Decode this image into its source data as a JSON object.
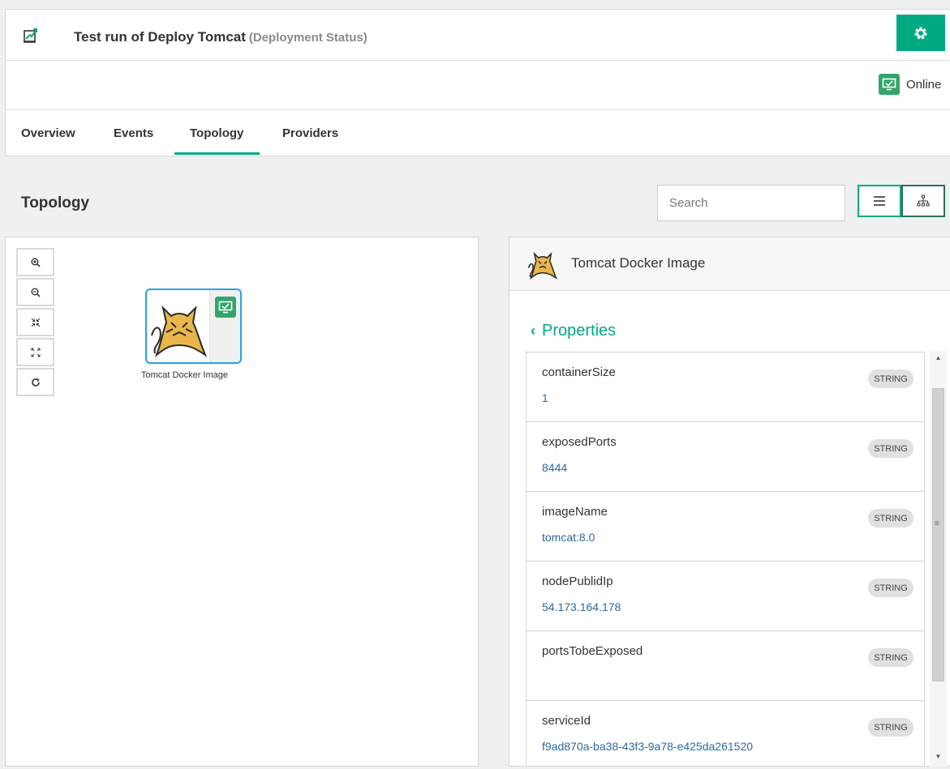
{
  "header": {
    "title": "Test run of Deploy Tomcat",
    "subtitle": "(Deployment Status)",
    "status_label": "Online"
  },
  "tabs": [
    {
      "label": "Overview",
      "active": false
    },
    {
      "label": "Events",
      "active": false
    },
    {
      "label": "Topology",
      "active": true
    },
    {
      "label": "Providers",
      "active": false
    }
  ],
  "topology": {
    "title": "Topology",
    "search_placeholder": "Search"
  },
  "canvas": {
    "zoom_icons": [
      "zoom-in-icon",
      "zoom-out-icon",
      "collapse-icon",
      "expand-icon",
      "refresh-icon"
    ],
    "node": {
      "label": "Tomcat Docker Image"
    }
  },
  "panel": {
    "name": "Tomcat Docker Image",
    "back_label": "Properties",
    "properties": [
      {
        "name": "containerSize",
        "value": "1",
        "type": "STRING"
      },
      {
        "name": "exposedPorts",
        "value": "8444",
        "type": "STRING"
      },
      {
        "name": "imageName",
        "value": "tomcat:8.0",
        "type": "STRING"
      },
      {
        "name": "nodePublidIp",
        "value": "54.173.164.178",
        "type": "STRING"
      },
      {
        "name": "portsTobeExposed",
        "value": "",
        "type": "STRING"
      },
      {
        "name": "serviceId",
        "value": "f9ad870a-ba38-43f3-9a78-e425da261520",
        "type": "STRING"
      }
    ]
  },
  "colors": {
    "accent": "#01a982",
    "online": "#33a56b",
    "node_border": "#2aa3e0",
    "value_text": "#2b6a9f"
  }
}
